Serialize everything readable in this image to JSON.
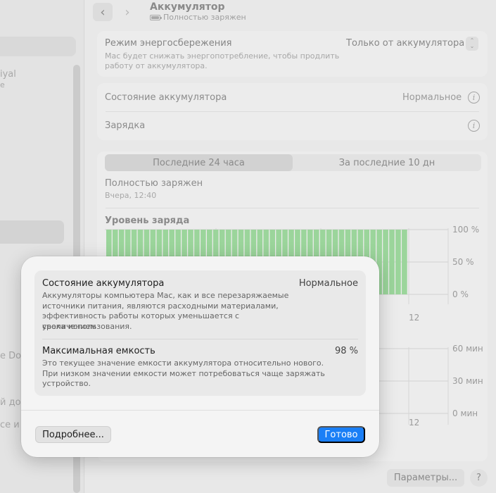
{
  "colors": {
    "accent": "#1a7ff6",
    "chart_bar": "#9bd59b",
    "chart_bar_edge": "#a6dba6"
  },
  "sidebar": {
    "fragments": [
      "iyal",
      "e",
      "e Doc",
      "й дос",
      "се и д"
    ]
  },
  "header": {
    "back_icon": "chevron-left-icon",
    "forward_icon": "chevron-right-icon",
    "title": "Аккумулятор",
    "subtitle": "Полностью заряжен",
    "battery_icon": "battery-full-icon"
  },
  "energy_mode": {
    "label": "Режим энергосбережения",
    "value": "Только от аккумулятора",
    "description_line1": "Mac будет снижать энергопотребление, чтобы продлить",
    "description_line2": "работу от аккумулятора."
  },
  "battery_health_row": {
    "label": "Состояние аккумулятора",
    "value": "Нормальное"
  },
  "charging_row": {
    "label": "Зарядка"
  },
  "history": {
    "tabs": [
      {
        "label": "Последние 24 часа",
        "active": true
      },
      {
        "label": "За последние 10 дн",
        "active": false
      }
    ],
    "status_title": "Полностью заряжен",
    "status_time": "Вчера, 12:40",
    "chart_title": "Уровень заряда"
  },
  "chart_data": [
    {
      "type": "bar",
      "title": "Уровень заряда",
      "y_tick_labels": [
        "100 %",
        "50 %",
        "0 %"
      ],
      "x_tick_labels": [
        "12"
      ],
      "ylim": [
        0,
        100
      ],
      "bar_count": 48,
      "values": [
        100,
        100,
        100,
        100,
        100,
        100,
        100,
        100,
        100,
        100,
        100,
        100,
        100,
        100,
        100,
        100,
        100,
        100,
        100,
        100,
        100,
        100,
        100,
        100,
        100,
        100,
        100,
        100,
        100,
        100,
        100,
        100,
        100,
        100,
        100,
        100,
        100,
        100,
        100,
        100,
        100,
        100,
        100,
        100,
        100,
        100,
        100,
        100
      ]
    },
    {
      "type": "bar",
      "title": "",
      "y_tick_labels": [
        "60 мин",
        "30 мин",
        "0 мин"
      ],
      "x_tick_labels": [
        "12"
      ],
      "ylim": [
        0,
        60
      ]
    }
  ],
  "footer": {
    "options_label": "Параметры...",
    "help_label": "?"
  },
  "sheet": {
    "health": {
      "title": "Состояние аккумулятора",
      "value": "Нормальное",
      "desc_line1": "Аккумуляторы компьютера Mac, как и все перезаряжаемые",
      "desc_line2": "источники питания, являются расходными материалами,",
      "desc_line3": "эффективность работы которых уменьшается с увеличением",
      "desc_line4": "срока использования."
    },
    "capacity": {
      "title": "Максимальная емкость",
      "value": "98 %",
      "desc_line1": "Это текущее значение емкости аккумулятора относительно нового.",
      "desc_line2": "При низком значении емкости может потребоваться чаще заряжать",
      "desc_line3": "устройство."
    },
    "more_button": "Подробнее...",
    "done_button": "Готово"
  }
}
